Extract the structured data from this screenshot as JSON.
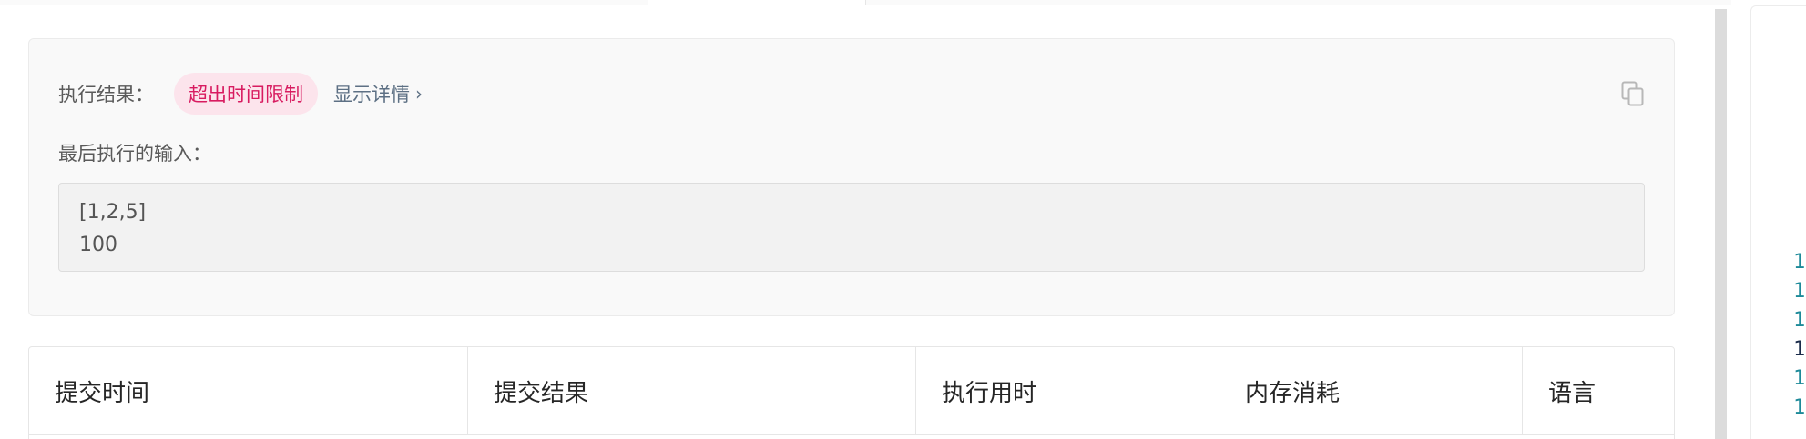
{
  "result": {
    "label": "执行结果：",
    "status": "超出时间限制",
    "details_link": "显示详情",
    "details_chevron": "›",
    "last_input_label": "最后执行的输入：",
    "last_input_lines": [
      "[1,2,5]",
      "100"
    ]
  },
  "table": {
    "headers": [
      "提交时间",
      "提交结果",
      "执行用时",
      "内存消耗",
      "语言"
    ]
  },
  "editor": {
    "line_numbers": [
      "1",
      "1",
      "1",
      "1",
      "1",
      "1"
    ]
  },
  "icons": {
    "copy": "copy-icon",
    "chevron": "chevron-right-icon"
  },
  "colors": {
    "status_text": "#d81b60",
    "status_bg": "#fce4ec",
    "link": "#5d7084",
    "line_number": "#1d8a99"
  }
}
